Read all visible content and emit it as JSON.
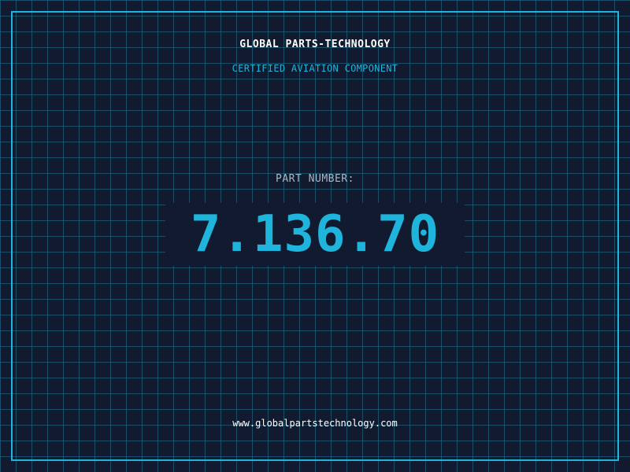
{
  "header": {
    "company_name": "GLOBAL PARTS-TECHNOLOGY",
    "certification": "CERTIFIED AVIATION COMPONENT"
  },
  "main": {
    "part_label": "PART NUMBER:",
    "part_number": "7.136.70"
  },
  "footer": {
    "website": "www.globalpartstechnology.com"
  },
  "colors": {
    "background": "#111a2e",
    "accent": "#1fb4dc",
    "grid": "#20788f",
    "text_primary": "#ffffff",
    "text_secondary": "#aab8c8"
  }
}
